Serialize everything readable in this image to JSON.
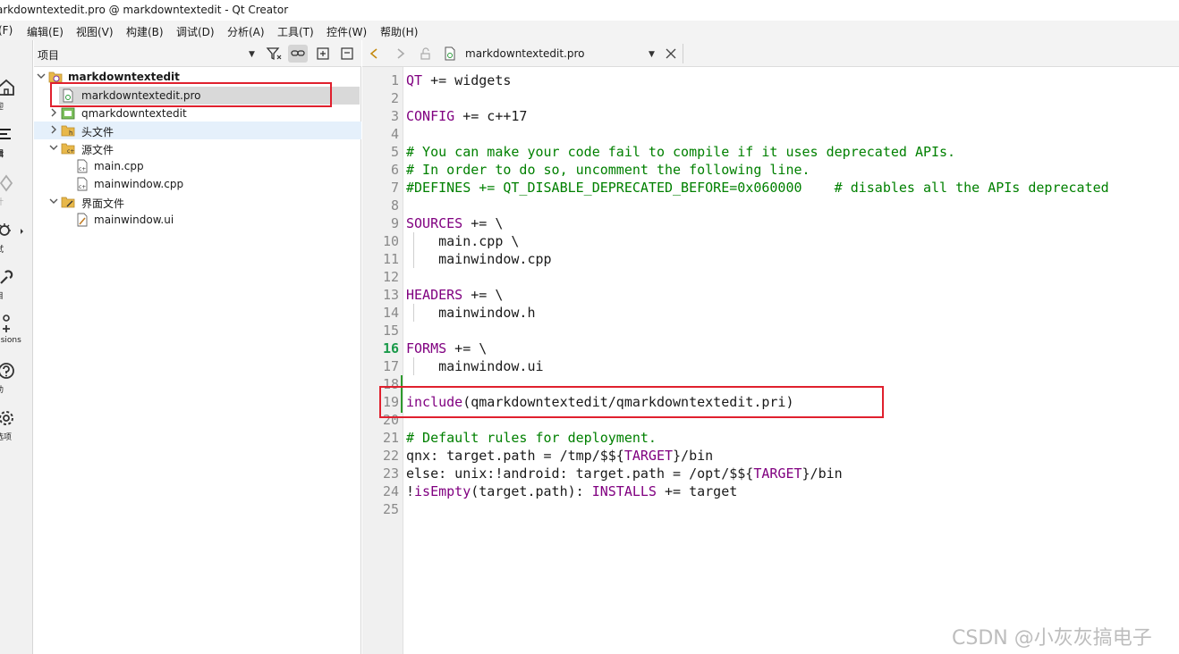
{
  "window": {
    "title": "arkdowntextedit.pro @ markdowntextedit - Qt Creator"
  },
  "menubar": {
    "items": [
      "(F)",
      "编辑(E)",
      "视图(V)",
      "构建(B)",
      "调试(D)",
      "分析(A)",
      "工具(T)",
      "控件(W)",
      "帮助(H)"
    ]
  },
  "modebar": {
    "items": [
      {
        "label": "欢迎",
        "icon": "home-icon"
      },
      {
        "label": "编辑",
        "icon": "edit-icon"
      },
      {
        "label": "设计",
        "icon": "design-icon"
      },
      {
        "label": "调试",
        "icon": "debug-icon"
      },
      {
        "label": "项目",
        "icon": "wrench-icon"
      },
      {
        "label": "Extensions",
        "icon": "extensions-icon"
      },
      {
        "label": "帮助",
        "icon": "help-icon"
      },
      {
        "label": "选项",
        "icon": "gear-icon"
      }
    ],
    "label_shown": [
      "迎",
      "辑",
      "计",
      "试",
      "目",
      "nsions",
      "助",
      "选项"
    ]
  },
  "project_panel": {
    "combo_label": "项目",
    "tree": [
      {
        "label": "markdowntextedit",
        "level": 0,
        "expanded": true,
        "bold": true,
        "icon": "qt-project-icon"
      },
      {
        "label": "markdowntextedit.pro",
        "level": 1,
        "selected": true,
        "icon": "pro-file-icon"
      },
      {
        "label": "qmarkdowntextedit",
        "level": 1,
        "expanded": false,
        "icon": "subproject-icon"
      },
      {
        "label": "头文件",
        "level": 1,
        "expanded": false,
        "icon": "header-folder-icon"
      },
      {
        "label": "源文件",
        "level": 1,
        "expanded": true,
        "icon": "source-folder-icon"
      },
      {
        "label": "main.cpp",
        "level": 2,
        "icon": "cpp-file-icon"
      },
      {
        "label": "mainwindow.cpp",
        "level": 2,
        "icon": "cpp-file-icon"
      },
      {
        "label": "界面文件",
        "level": 1,
        "expanded": true,
        "icon": "ui-folder-icon"
      },
      {
        "label": "mainwindow.ui",
        "level": 2,
        "icon": "ui-file-icon"
      }
    ]
  },
  "editor": {
    "filename": "markdowntextedit.pro",
    "current_line": 16,
    "lines": [
      "QT += widgets",
      "",
      "CONFIG += c++17",
      "",
      "# You can make your code fail to compile if it uses deprecated APIs.",
      "# In order to do so, uncomment the following line.",
      "#DEFINES += QT_DISABLE_DEPRECATED_BEFORE=0x060000    # disables all the APIs deprecated",
      "",
      "SOURCES += \\",
      "    main.cpp \\",
      "    mainwindow.cpp",
      "",
      "HEADERS += \\",
      "    mainwindow.h",
      "",
      "FORMS += \\",
      "    mainwindow.ui",
      "",
      "include(qmarkdowntextedit/qmarkdowntextedit.pri)",
      "",
      "# Default rules for deployment.",
      "qnx: target.path = /tmp/$${TARGET}/bin",
      "else: unix:!android: target.path = /opt/$${TARGET}/bin",
      "!isEmpty(target.path): INSTALLS += target",
      ""
    ]
  },
  "colors": {
    "keyword": "#800080",
    "comment": "#008000",
    "highlight_box": "#e0202e",
    "current_line_number": "#1a9a4a"
  },
  "watermark": "CSDN @小灰灰搞电子"
}
